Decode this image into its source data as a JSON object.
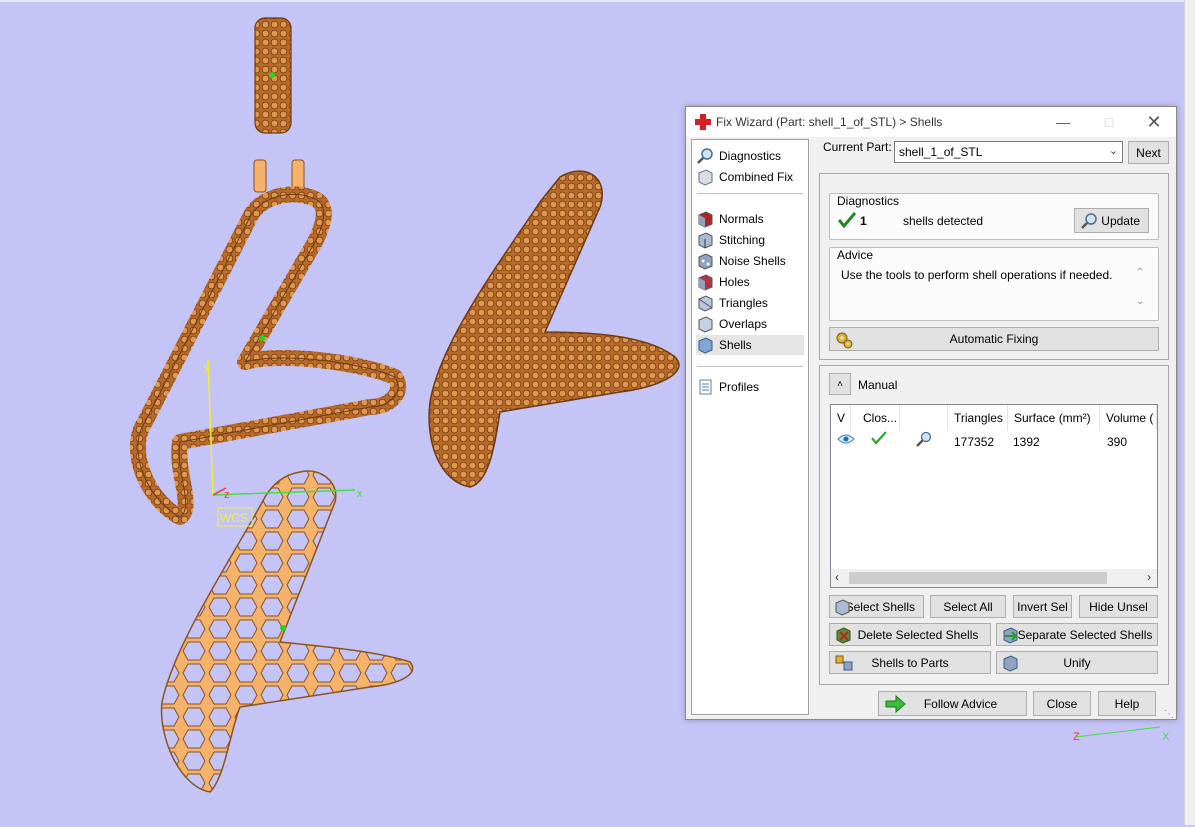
{
  "viewport": {
    "axis_labels": {
      "x": "x",
      "y": "y",
      "z": "z",
      "wcs": "WCS"
    },
    "mini_axis": {
      "z": "Z",
      "x": "X"
    }
  },
  "dialog": {
    "title": "Fix Wizard (Part: shell_1_of_STL) > Shells",
    "nav": {
      "diagnostics": "Diagnostics",
      "combined_fix": "Combined Fix",
      "normals": "Normals",
      "stitching": "Stitching",
      "noise_shells": "Noise Shells",
      "holes": "Holes",
      "triangles": "Triangles",
      "overlaps": "Overlaps",
      "shells": "Shells",
      "profiles": "Profiles"
    },
    "current_part_label": "Current Part:",
    "current_part_value": "shell_1_of_STL",
    "next_button": "Next",
    "diagnostics": {
      "title": "Diagnostics",
      "count": "1",
      "text": "shells detected",
      "update_button": "Update"
    },
    "advice": {
      "title": "Advice",
      "text": "Use the tools to perform shell operations if needed."
    },
    "automatic_fixing": "Automatic Fixing",
    "manual": {
      "title": "Manual",
      "columns": [
        "V",
        "Clos...",
        "",
        "Triangles",
        "Surface (mm²)",
        "Volume ("
      ],
      "row": {
        "triangles": "177352",
        "surface": "1392",
        "volume": "390"
      }
    },
    "buttons": {
      "select_shells": "Select Shells",
      "select_all": "Select All",
      "invert_sel": "Invert Sel",
      "hide_unsel": "Hide Unsel",
      "delete_selected": "Delete Selected Shells",
      "separate_selected": "Separate Selected Shells",
      "shells_to_parts": "Shells to Parts",
      "unify": "Unify",
      "follow_advice": "Follow Advice",
      "close": "Close",
      "help": "Help"
    }
  }
}
